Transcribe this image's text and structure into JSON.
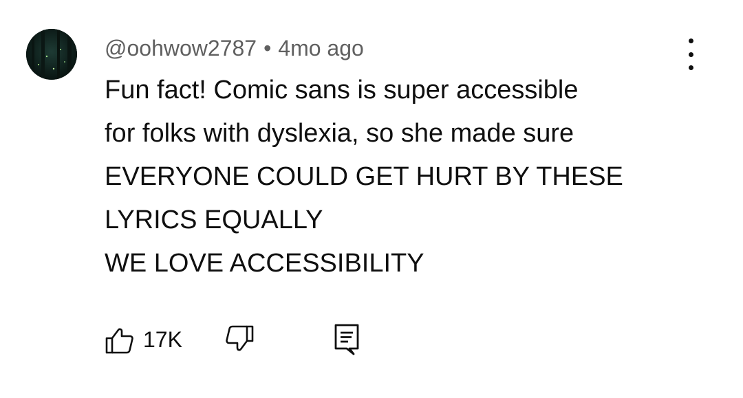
{
  "comment": {
    "author": "@oohwow2787",
    "separator": "•",
    "time": "4mo ago",
    "lines": [
      "Fun fact! Comic sans is super accessible",
      "for folks with dyslexia, so she made sure",
      "EVERYONE COULD GET HURT BY THESE",
      "LYRICS EQUALLY",
      "WE LOVE ACCESSIBILITY"
    ],
    "like_count": "17K"
  },
  "icons": {
    "avatar": "avatar-image",
    "menu": "more-vert-icon",
    "like": "thumbs-up-icon",
    "dislike": "thumbs-down-icon",
    "reply": "reply-comment-icon"
  },
  "colors": {
    "text": "#0f0f0f",
    "secondary_text": "#606060",
    "background": "#ffffff"
  }
}
